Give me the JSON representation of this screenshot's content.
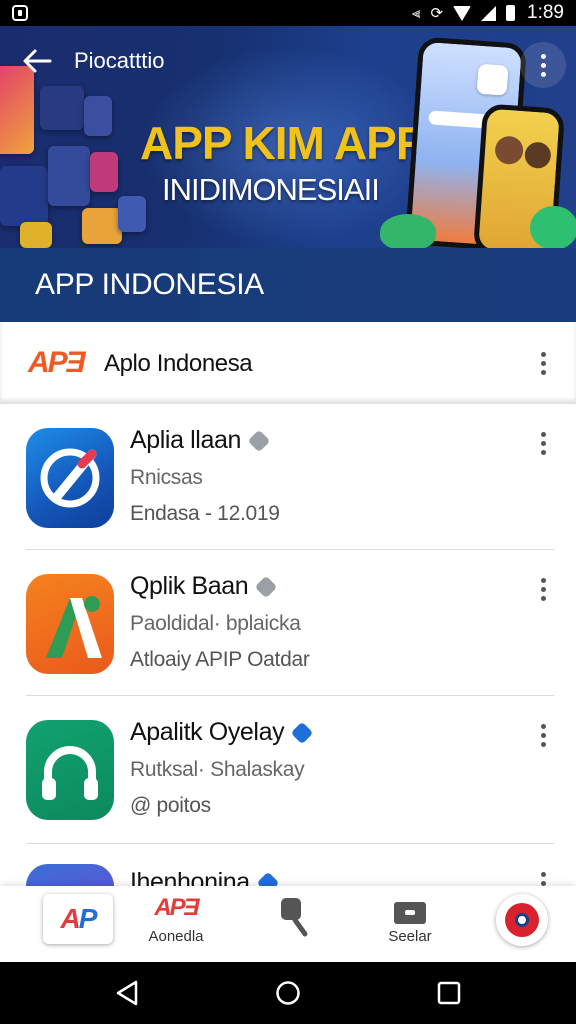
{
  "status_bar": {
    "time": "1:89",
    "icons": [
      "notification-icon",
      "vibrate-icon",
      "sync-icon",
      "wifi-icon",
      "signal-icon",
      "battery-icon"
    ]
  },
  "hero": {
    "title": "Piocatttio",
    "headline": "APP KIM APR",
    "subheadline": "INIDIMONESIAII",
    "back_icon": "back-arrow-icon",
    "more_icon": "more-vert-icon"
  },
  "section": {
    "title": "APP INDONESIA"
  },
  "list_header": {
    "logo_text": "APƎ",
    "label": "Aplo Indonesa"
  },
  "apps": [
    {
      "name": "Aplia llaan",
      "subtitle": "Rnicsas",
      "meta": "Endasa - 12.019",
      "badge_color": "#9aa0a6"
    },
    {
      "name": "Qplik Baan",
      "subtitle": "Paoldidal· bplaicka",
      "meta": "Atloaiy APIP Oatdar",
      "badge_color": "#9aa0a6"
    },
    {
      "name": "Apalitk Oyelay",
      "subtitle": "Rutksal· Shalaskay",
      "meta": "@ poitos",
      "badge_color": "#1e6fd9"
    },
    {
      "name": "Ihenhonina",
      "subtitle": "",
      "meta": "",
      "badge_color": "#1e6fd9"
    }
  ],
  "bottom_nav": {
    "items": [
      {
        "label": "",
        "icon": "app-logo-icon"
      },
      {
        "label": "Aonedla",
        "icon": "app-logo-small-icon"
      },
      {
        "label": "",
        "icon": "search-icon"
      },
      {
        "label": "Seelar",
        "icon": "folder-icon"
      },
      {
        "label": "",
        "icon": "chat-icon"
      }
    ]
  },
  "colors": {
    "hero_bg": "#1b2c6e",
    "band_bg": "#173a78",
    "headline": "#f1c21b",
    "accent_orange": "#ee5a24",
    "verified_blue": "#1e6fd9"
  }
}
